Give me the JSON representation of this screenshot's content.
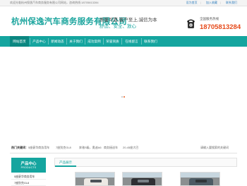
{
  "topbar": {
    "welcome": "欢迎光临杭州保逸汽车商务服务有限公司网站，咨询热线:18705813284",
    "links": [
      "设为首页",
      "加入收藏",
      "联系我们"
    ]
  },
  "header": {
    "company_name": "杭州保逸汽车商务服务有限公司",
    "slogan_line1": "质量可靠,客户至上,诚信为本",
    "slogan_line2": "舒适、安全、放心",
    "hotline_label": "全国服务热线",
    "hotline_number": "18705813284"
  },
  "nav": {
    "items": [
      "网站首页",
      "产品中心",
      "新闻动态",
      "关于我们",
      "成功案例",
      "荣誉资质",
      "在线留言",
      "联系我们"
    ],
    "active_index": 0
  },
  "banner": {
    "slide_count": 2,
    "active_slide": 1
  },
  "keywords": {
    "label": "热门关键词：",
    "items": [
      "5座豪华商务用车",
      "7座别克GL8",
      "奔驰S级，奥迪A6",
      "商务接送车",
      "20-45座大巴"
    ],
    "search_hint": "请输入要搜索的关键词"
  },
  "sidebar": {
    "title": "产品中心",
    "subtitle": "PRODUCTS",
    "items": [
      "5座豪华商务用车",
      "7座别克GL8"
    ]
  },
  "products": {
    "title": "产品展示"
  },
  "colors": {
    "brand": "#15a59f",
    "brand_dark": "#0b8781",
    "hotline": "#e64a1a",
    "car_colors": [
      "#ece9e4",
      "#2e2f33",
      "#4c5a63"
    ]
  }
}
